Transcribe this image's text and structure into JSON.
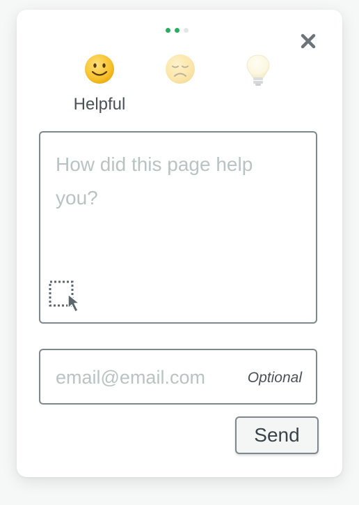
{
  "steps": {
    "total": 3,
    "completed": 2,
    "active_color": "#27ae60",
    "inactive_color": "#e3e6e6"
  },
  "close_icon": "close-icon",
  "ratings": [
    {
      "icon": "smiley-face-icon",
      "label": "Helpful",
      "selected": true
    },
    {
      "icon": "sad-face-icon",
      "selected": false
    },
    {
      "icon": "lightbulb-icon",
      "selected": false
    }
  ],
  "feedback": {
    "placeholder": "How did this page help you?",
    "screenshot_icon": "screenshot-select-icon"
  },
  "email": {
    "placeholder": "email@email.com",
    "optional_label": "Optional"
  },
  "send_label": "Send",
  "colors": {
    "border": "#7d878c",
    "placeholder": "#b9c3c1",
    "text": "#4a5157",
    "emoji_yellow": "#f5c02a"
  }
}
